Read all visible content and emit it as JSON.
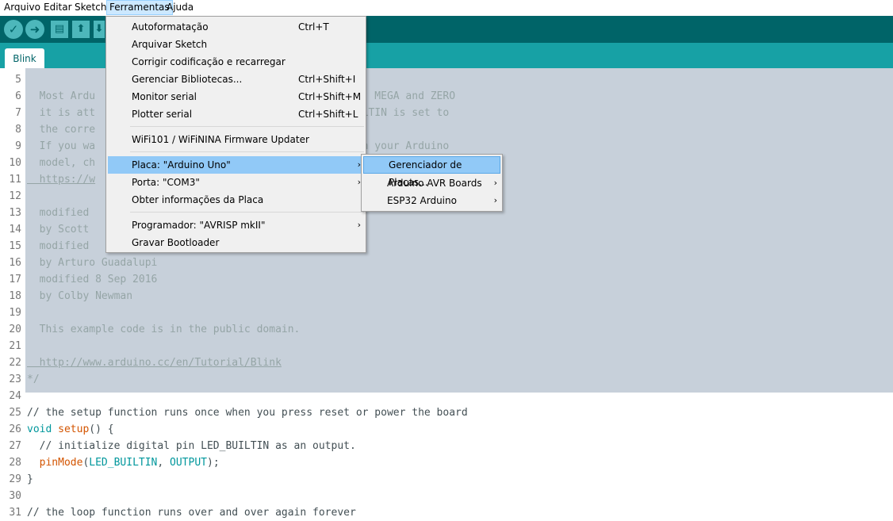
{
  "menubar": {
    "items": [
      "Arquivo",
      "Editar",
      "Sketch",
      "Ferramentas",
      "Ajuda"
    ]
  },
  "toolbar": {
    "verify_icon": "check-icon",
    "upload_icon": "arrow-right-icon",
    "new_icon": "new-file-icon",
    "open_icon": "arrow-up-icon",
    "save_icon": "arrow-down-icon"
  },
  "tabs": [
    "Blink"
  ],
  "colors": {
    "toolbar": "#006468",
    "tabstrip": "#17a1a5",
    "selection": "#c7d0da",
    "menu_highlight": "#91c9f7"
  },
  "tools_menu": {
    "items": [
      {
        "label": "Autoformatação",
        "shortcut": "Ctrl+T"
      },
      {
        "label": "Arquivar Sketch",
        "shortcut": ""
      },
      {
        "label": "Corrigir codificação e recarregar",
        "shortcut": ""
      },
      {
        "label": "Gerenciar Bibliotecas...",
        "shortcut": "Ctrl+Shift+I"
      },
      {
        "label": "Monitor serial",
        "shortcut": "Ctrl+Shift+M"
      },
      {
        "label": "Plotter serial",
        "shortcut": "Ctrl+Shift+L"
      },
      {
        "label": "WiFi101 / WiFiNINA Firmware Updater",
        "shortcut": ""
      },
      {
        "label": "Placa: \"Arduino Uno\"",
        "shortcut": ""
      },
      {
        "label": "Porta: \"COM3\"",
        "shortcut": ""
      },
      {
        "label": "Obter informações da Placa",
        "shortcut": ""
      },
      {
        "label": "Programador: \"AVRISP mkII\"",
        "shortcut": ""
      },
      {
        "label": "Gravar Bootloader",
        "shortcut": ""
      }
    ]
  },
  "board_submenu": {
    "items": [
      {
        "label": "Gerenciador de Placas..."
      },
      {
        "label": "Arduino AVR Boards"
      },
      {
        "label": "ESP32 Arduino"
      }
    ]
  },
  "code": {
    "lines": [
      {
        "n": "5",
        "t": ""
      },
      {
        "n": "6",
        "t": "  Most Ardu                          ntrol. On the UNO, MEGA and ZERO"
      },
      {
        "n": "7",
        "t": "  it is att                          on pin 6. LED_BUILTIN is set to"
      },
      {
        "n": "8",
        "t": "  the corre                          d is used."
      },
      {
        "n": "9",
        "t": "  If you wa                          is connected to on your Arduino"
      },
      {
        "n": "10",
        "t": "  model, ch"
      },
      {
        "n": "11",
        "t": "  https://w"
      },
      {
        "n": "12",
        "t": ""
      },
      {
        "n": "13",
        "t": "  modified"
      },
      {
        "n": "14",
        "t": "  by Scott"
      },
      {
        "n": "15",
        "t": "  modified"
      },
      {
        "n": "16",
        "t": "  by Arturo Guadalupi"
      },
      {
        "n": "17",
        "t": "  modified 8 Sep 2016"
      },
      {
        "n": "18",
        "t": "  by Colby Newman"
      },
      {
        "n": "19",
        "t": ""
      },
      {
        "n": "20",
        "t": "  This example code is in the public domain."
      },
      {
        "n": "21",
        "t": ""
      },
      {
        "n": "22",
        "t": "  http://www.arduino.cc/en/Tutorial/Blink"
      },
      {
        "n": "23",
        "t": "*/"
      },
      {
        "n": "24",
        "t": ""
      },
      {
        "n": "25",
        "t": "// the setup function runs once when you press reset or power the board"
      },
      {
        "n": "26",
        "t": ""
      },
      {
        "n": "27",
        "t": "  // initialize digital pin LED_BUILTIN as an output."
      },
      {
        "n": "28",
        "t": ""
      },
      {
        "n": "29",
        "t": "}"
      },
      {
        "n": "30",
        "t": ""
      },
      {
        "n": "31",
        "t": "// the loop function runs over and over again forever"
      }
    ],
    "setup_kw": "void",
    "setup_fn": "setup",
    "setup_rest": "() {",
    "pinmode_fn": "pinMode",
    "pinmode_open": "(",
    "pinmode_arg1": "LED_BUILTIN",
    "pinmode_comma": ", ",
    "pinmode_arg2": "OUTPUT",
    "pinmode_close": ");"
  }
}
